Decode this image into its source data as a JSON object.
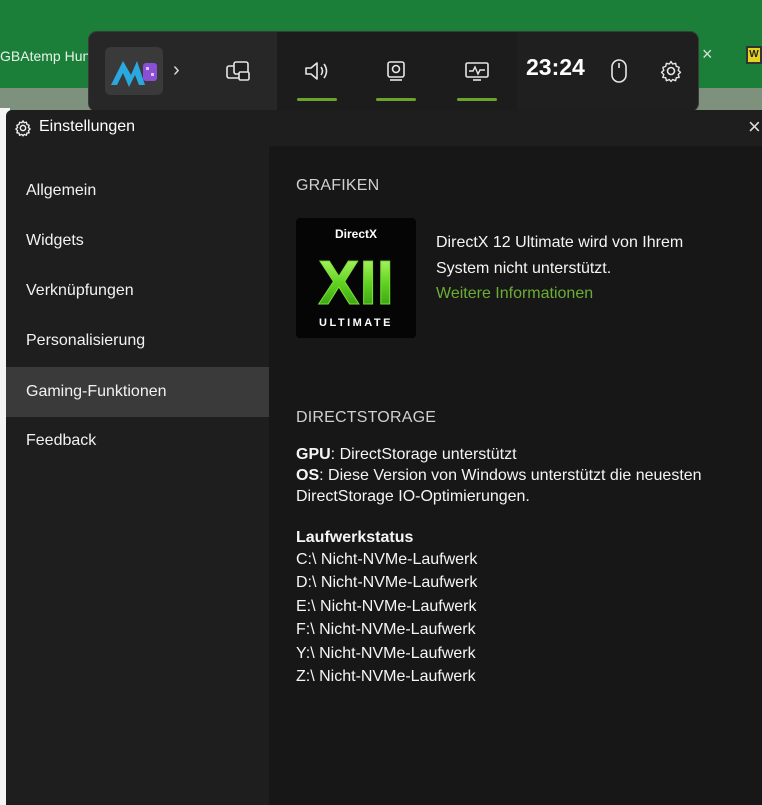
{
  "background": {
    "tab_text": "GBAtemp Hun",
    "tab_close": "×"
  },
  "gamebar": {
    "time": "23:24",
    "chevron": "›"
  },
  "panel": {
    "title": "Einstellungen",
    "close": "×"
  },
  "nav": {
    "items": [
      {
        "label": "Allgemein"
      },
      {
        "label": "Widgets"
      },
      {
        "label": "Verknüpfungen"
      },
      {
        "label": "Personalisierung"
      },
      {
        "label": "Gaming-Funktionen"
      },
      {
        "label": "Feedback"
      }
    ]
  },
  "graphics": {
    "heading": "GRAFIKEN",
    "logo_top": "DirectX",
    "logo_mid": "XII",
    "logo_bottom": "ULTIMATE",
    "message_line1": "DirectX 12 Ultimate wird von Ihrem",
    "message_line2": "System nicht unterstützt.",
    "link": "Weitere Informationen"
  },
  "directstorage": {
    "heading": "DIRECTSTORAGE",
    "gpu_label": "GPU",
    "gpu_value": ": DirectStorage unterstützt",
    "os_label": "OS",
    "os_value_line1": ": Diese Version von Windows unterstützt die neuesten",
    "os_value_line2": "DirectStorage IO-Optimierungen.",
    "drive_status_heading": "Laufwerkstatus",
    "drives": [
      "C:\\ Nicht-NVMe-Laufwerk",
      "D:\\ Nicht-NVMe-Laufwerk",
      "E:\\ Nicht-NVMe-Laufwerk",
      "F:\\ Nicht-NVMe-Laufwerk",
      "Y:\\ Nicht-NVMe-Laufwerk",
      "Z:\\ Nicht-NVMe-Laufwerk"
    ]
  },
  "colors": {
    "accent_green": "#6ba32b",
    "link_green": "#6cad34",
    "panel_bg": "#1e1e1e",
    "content_bg": "#171717",
    "active_nav_bg": "#3a3a3a"
  }
}
